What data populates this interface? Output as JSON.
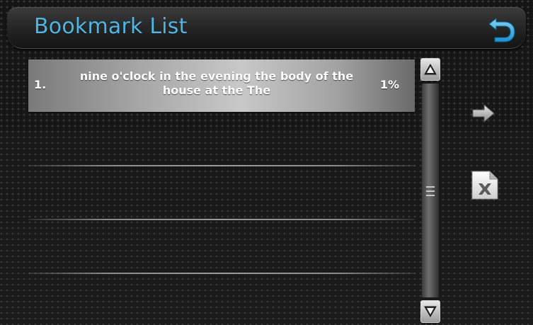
{
  "header": {
    "title": "Bookmark List",
    "back_icon": "undo-arrow-icon",
    "title_color": "#4fb5e3"
  },
  "bookmarks": [
    {
      "index": "1.",
      "text": "nine o'clock in the evening the body of the house at the The",
      "percent": "1%",
      "selected": true
    }
  ],
  "empty_slots": 3,
  "scrollbar": {
    "up_icon": "scroll-up-triangle-icon",
    "down_icon": "scroll-down-triangle-icon",
    "grip_icon": "scroll-grip-icon"
  },
  "actions": {
    "next_icon": "right-arrow-icon",
    "delete_icon": "delete-file-icon"
  },
  "colors": {
    "accent": "#4fb5e3",
    "background": "#161616"
  }
}
